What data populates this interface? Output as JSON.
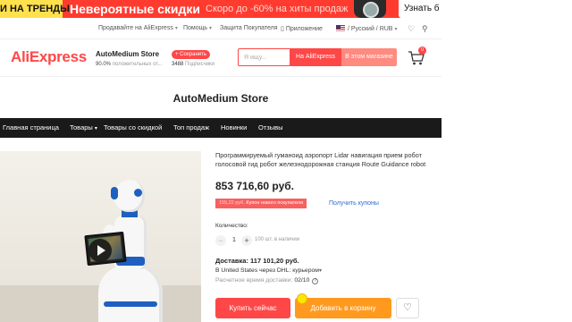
{
  "promo": {
    "left_text": "И НА ТРЕНДЫ",
    "headline": "Невероятные скидки",
    "subline": "Скоро до -60% на хиты продаж",
    "button": "Узнать б"
  },
  "top_links": {
    "sell": "Продавайте на AliExpress",
    "help": "Помощь",
    "protection": "Защита Покупателя",
    "app": "Приложение",
    "locale": "/ Русский / RUB"
  },
  "header": {
    "logo": "AliExpress",
    "store_name": "AutoMedium Store",
    "rating_value": "90.0%",
    "rating_text": "положительных от...",
    "save_label": "+ Сохранить",
    "followers_value": "3488",
    "followers_text": "Подписчики",
    "search_placeholder": "Я ищу...",
    "search_ali": "На AliExpress",
    "search_store": "В этом магазине",
    "cart_count": "0"
  },
  "banner": {
    "title": "AutoMedium Store"
  },
  "nav": {
    "items": [
      "Главная страница",
      "Товары",
      "Товары со скидкой",
      "Топ продаж",
      "Новинки",
      "Отзывы"
    ]
  },
  "product": {
    "title": "Программируемый гуманоид аэропорт Lidar навигация прием робот голосовой гид робот железнодорожная станция Route Guidance robot",
    "price": "853 716,60 руб.",
    "coupon_amount": "155,22 руб.",
    "coupon_text": "Купон нового покупателя",
    "get_coupons": "Получить купоны",
    "qty_label": "Количество:",
    "qty_value": "1",
    "qty_avail": "100 шт. в наличии",
    "shipping": "Доставка: 117 101,20 руб.",
    "shipping_via": "В United States через DHL: курьером",
    "delivery_label": "Расчетное время доставки:",
    "delivery_date": "02/10",
    "buy_now": "Купить сейчас",
    "add_to_cart": "Добавить в корзину"
  },
  "colors": {
    "accent": "#ff4747",
    "cart_button": "#ff9a1f",
    "nav_bg": "#1a1a1a",
    "link": "#2b6fd6"
  }
}
